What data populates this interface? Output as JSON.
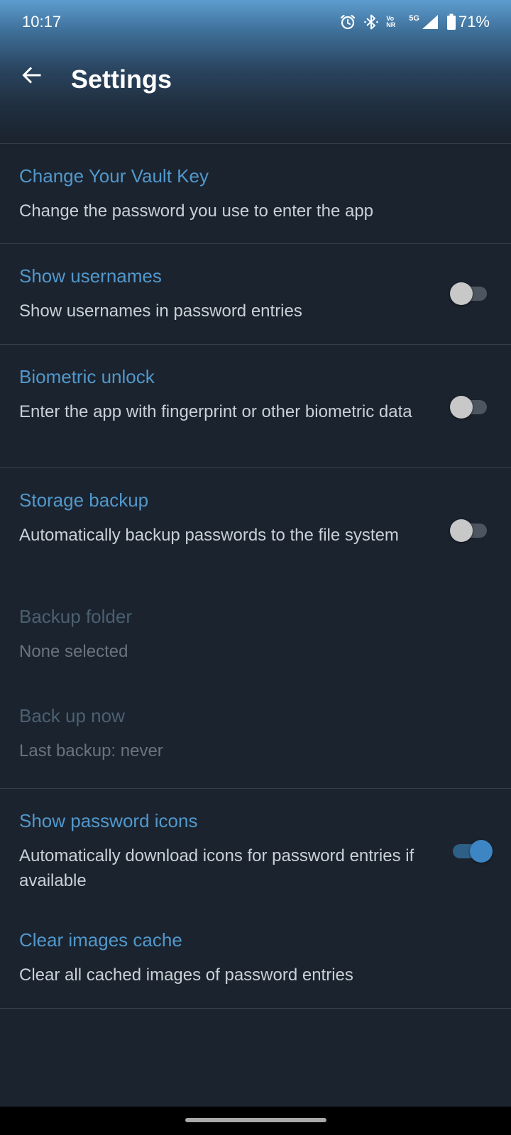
{
  "status_bar": {
    "time": "10:17",
    "volte_top": "Vo",
    "volte_bottom": "NR",
    "network": "5G",
    "battery": "71%",
    "icons": [
      "alarm-icon",
      "bluetooth-icon",
      "volte-icon",
      "signal-icon",
      "battery-icon"
    ]
  },
  "header": {
    "title": "Settings",
    "back_icon": "arrow-left-icon"
  },
  "settings": [
    {
      "title": "Change Your Vault Key",
      "summary": "Change the password you use to enter the app"
    },
    {
      "title": "Show usernames",
      "summary": "Show usernames in password entries",
      "toggle": false
    },
    {
      "title": "Biometric unlock",
      "summary": "Enter the app with fingerprint or other biometric data",
      "toggle": false
    },
    {
      "title": "Storage backup",
      "summary": "Automatically backup passwords to the file system",
      "toggle": false
    },
    {
      "title": "Backup folder",
      "summary": "None selected",
      "disabled": true
    },
    {
      "title": "Back up now",
      "summary": "Last backup: never",
      "disabled": true
    },
    {
      "title": "Show password icons",
      "summary": "Automatically download icons for password entries if available",
      "toggle": true
    },
    {
      "title": "Clear images cache",
      "summary": "Clear all cached images of password entries"
    }
  ],
  "colors": {
    "background": "#1b232e",
    "accent": "#5198cc",
    "summary_text": "#c9d0d7",
    "divider": "#34404c",
    "toggle_on": "#3d86c3"
  }
}
